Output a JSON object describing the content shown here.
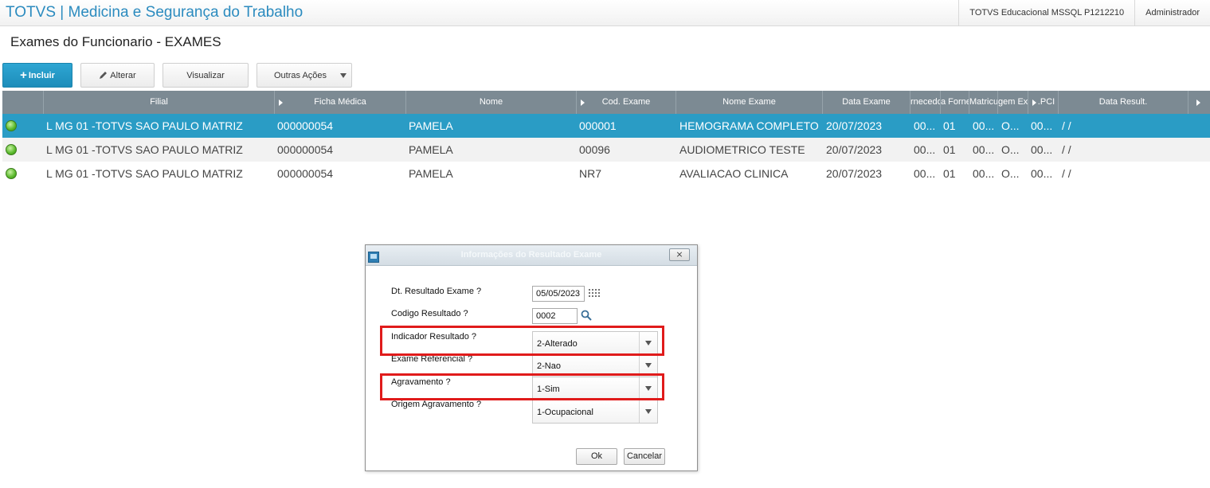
{
  "header": {
    "app_title": "TOTVS | Medicina e Segurança do Trabalho",
    "environment": "TOTVS Educacional MSSQL P1212210",
    "user": "Administrador"
  },
  "page": {
    "title": "Exames do Funcionario - EXAMES"
  },
  "toolbar": {
    "incluir": "Incluir",
    "alterar": "Alterar",
    "visualizar": "Visualizar",
    "outras_acoes": "Outras Ações"
  },
  "grid": {
    "columns": [
      "Filial",
      "Ficha Médica",
      "Nome",
      "Cod. Exame",
      "Nome Exame",
      "Data Exame",
      "rnecedo",
      "a Forne",
      "Matricula",
      "gem Exa",
      ".PCI",
      "Data Result."
    ],
    "rows": [
      [
        "L MG 01 -TOTVS SAO PAULO MATRIZ",
        "000000054",
        "PAMELA",
        "000001",
        "HEMOGRAMA COMPLETO",
        "20/07/2023",
        "00...",
        "01",
        "00...",
        "O...",
        "00...",
        " /  /"
      ],
      [
        "L MG 01 -TOTVS SAO PAULO MATRIZ",
        "000000054",
        "PAMELA",
        "00096",
        "AUDIOMETRICO TESTE",
        "20/07/2023",
        "00...",
        "01",
        "00...",
        "O...",
        "00...",
        " /  /"
      ],
      [
        "L MG 01 -TOTVS SAO PAULO MATRIZ",
        "000000054",
        "PAMELA",
        "NR7",
        "AVALIACAO CLINICA",
        "20/07/2023",
        "00...",
        "01",
        "00...",
        "O...",
        "00...",
        " /  /"
      ]
    ]
  },
  "dialog": {
    "title": "Informações do Resultado Exame",
    "close": "⨯",
    "fields": {
      "dt_resultado": {
        "label": "Dt. Resultado Exame ?",
        "value": "05/05/2023"
      },
      "codigo_resultado": {
        "label": "Codigo Resultado ?",
        "value": "0002"
      },
      "indicador_resultado": {
        "label": "Indicador Resultado ?",
        "value": "2-Alterado"
      },
      "exame_referencial": {
        "label": "Exame Referencial ?",
        "value": "2-Nao"
      },
      "agravamento": {
        "label": "Agravamento ?",
        "value": "1-Sim"
      },
      "origem_agravamento": {
        "label": "Origem Agravamento ?",
        "value": "1-Ocupacional"
      }
    },
    "ok": "Ok",
    "cancel": "Cancelar"
  },
  "colors": {
    "accent": "#2a9cc5",
    "grid_header": "#7c8a93",
    "highlight": "#e01b1b",
    "status_ok": "#58b82a"
  }
}
